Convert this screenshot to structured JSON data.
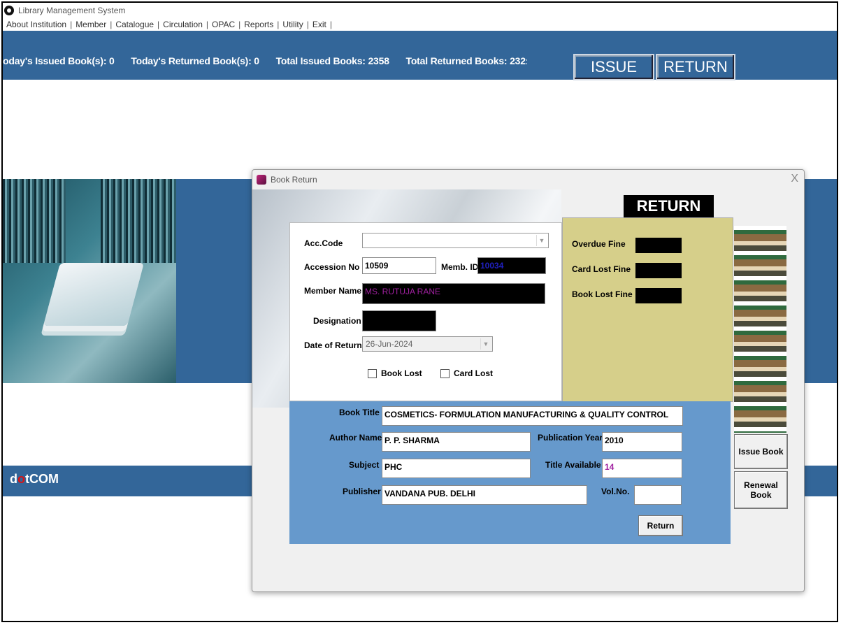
{
  "window": {
    "title": "Library Management System"
  },
  "menu": [
    "About Institution",
    "Member",
    "Catalogue",
    "Circulation",
    "OPAC",
    "Reports",
    "Utility",
    "Exit"
  ],
  "stats": {
    "today_issued": "oday's Issued Book(s): 0",
    "today_returned": "Today's Returned Book(s): 0",
    "total_issued": "Total Issued Books: 2358",
    "total_returned": "Total Returned Books: 232:"
  },
  "top_buttons": {
    "issue": "ISSUE",
    "return": "RETURN"
  },
  "brand": {
    "pre": "d",
    "dot": "o",
    "post": "tCOM"
  },
  "dialog": {
    "title": "Book Return",
    "close": "X",
    "header": "RETURN",
    "acc_code": {
      "label": "Acc.Code",
      "value": ""
    },
    "accession_no": {
      "label": "Accession No",
      "value": "10509"
    },
    "memb_id": {
      "label": "Memb. ID",
      "value": "10034"
    },
    "member_name": {
      "label": "Member Name",
      "value": "MS. RUTUJA RANE"
    },
    "designation": {
      "label": "Designation",
      "value": ""
    },
    "date_of_return": {
      "label": "Date of Return",
      "value": "26-Jun-2024"
    },
    "book_lost": "Book Lost",
    "card_lost": "Card Lost",
    "fines": {
      "overdue": "Overdue Fine",
      "card_lost": "Card Lost Fine",
      "book_lost": "Book Lost Fine"
    },
    "book": {
      "title_label": "Book Title",
      "title": "COSMETICS- FORMULATION MANUFACTURING & QUALITY CONTROL",
      "author_label": "Author Name",
      "author": "P. P. SHARMA",
      "pubyear_label": "Publication Year",
      "pubyear": "2010",
      "subject_label": "Subject",
      "subject": "PHC",
      "available_label": "Title Available",
      "available": "14",
      "publisher_label": "Publisher",
      "publisher": "VANDANA PUB. DELHI",
      "volno_label": "Vol.No.",
      "volno": ""
    },
    "return_button": "Return",
    "issue_book_button": "Issue Book",
    "renewal_book_button": "Renewal Book"
  }
}
